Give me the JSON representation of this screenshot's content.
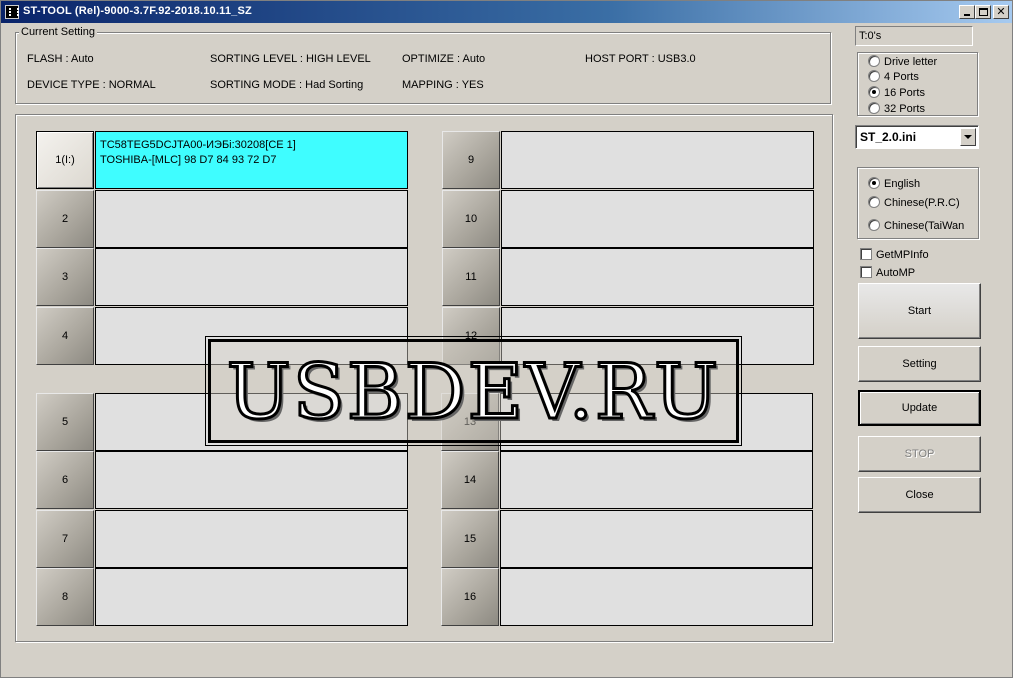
{
  "window": {
    "title": "ST-TOOL (Rel)-9000-3.7F.92-2018.10.11_SZ"
  },
  "current_setting": {
    "label": "Current Setting",
    "flash": "FLASH : Auto",
    "device_type": "DEVICE TYPE : NORMAL",
    "sorting_level": "SORTING LEVEL : HIGH LEVEL",
    "sorting_mode": "SORTING MODE : Had Sorting",
    "optimize": "OPTIMIZE : Auto",
    "mapping": "MAPPING : YES",
    "host_port": "HOST PORT : USB3.0"
  },
  "timer": "T:0's",
  "port_mode": {
    "options": [
      "Drive letter",
      "4 Ports",
      "16 Ports",
      "32 Ports"
    ],
    "selected": "16 Ports"
  },
  "ini_file": "ST_2.0.ini",
  "language": {
    "options": [
      "English",
      "Chinese(P.R.C)",
      "Chinese(TaiWan"
    ],
    "selected": "English"
  },
  "checkboxes": {
    "getmpinfo": "GetMPInfo",
    "automp": "AutoMP"
  },
  "buttons": {
    "start": "Start",
    "setting": "Setting",
    "update": "Update",
    "stop": "STOP",
    "close": "Close"
  },
  "ports": [
    {
      "label": "1(I:)",
      "line1": "TC58TEG5DCJTA00-ИЭБі:30208[CE 1]",
      "line2": "TOSHIBA-[MLC] 98 D7 84 93 72 D7"
    },
    {
      "label": "2",
      "line1": "",
      "line2": ""
    },
    {
      "label": "3",
      "line1": "",
      "line2": ""
    },
    {
      "label": "4",
      "line1": "",
      "line2": ""
    },
    {
      "label": "5",
      "line1": "",
      "line2": ""
    },
    {
      "label": "6",
      "line1": "",
      "line2": ""
    },
    {
      "label": "7",
      "line1": "",
      "line2": ""
    },
    {
      "label": "8",
      "line1": "",
      "line2": ""
    },
    {
      "label": "9",
      "line1": "",
      "line2": ""
    },
    {
      "label": "10",
      "line1": "",
      "line2": ""
    },
    {
      "label": "11",
      "line1": "",
      "line2": ""
    },
    {
      "label": "12",
      "line1": "",
      "line2": ""
    },
    {
      "label": "13",
      "line1": "",
      "line2": ""
    },
    {
      "label": "14",
      "line1": "",
      "line2": ""
    },
    {
      "label": "15",
      "line1": "",
      "line2": ""
    },
    {
      "label": "16",
      "line1": "",
      "line2": ""
    }
  ],
  "watermark": "USBDEV.RU",
  "colors": {
    "active_port_bg": "#3ffdff",
    "titlebar_start": "#0a246a",
    "window_bg": "#d4d0c8"
  }
}
